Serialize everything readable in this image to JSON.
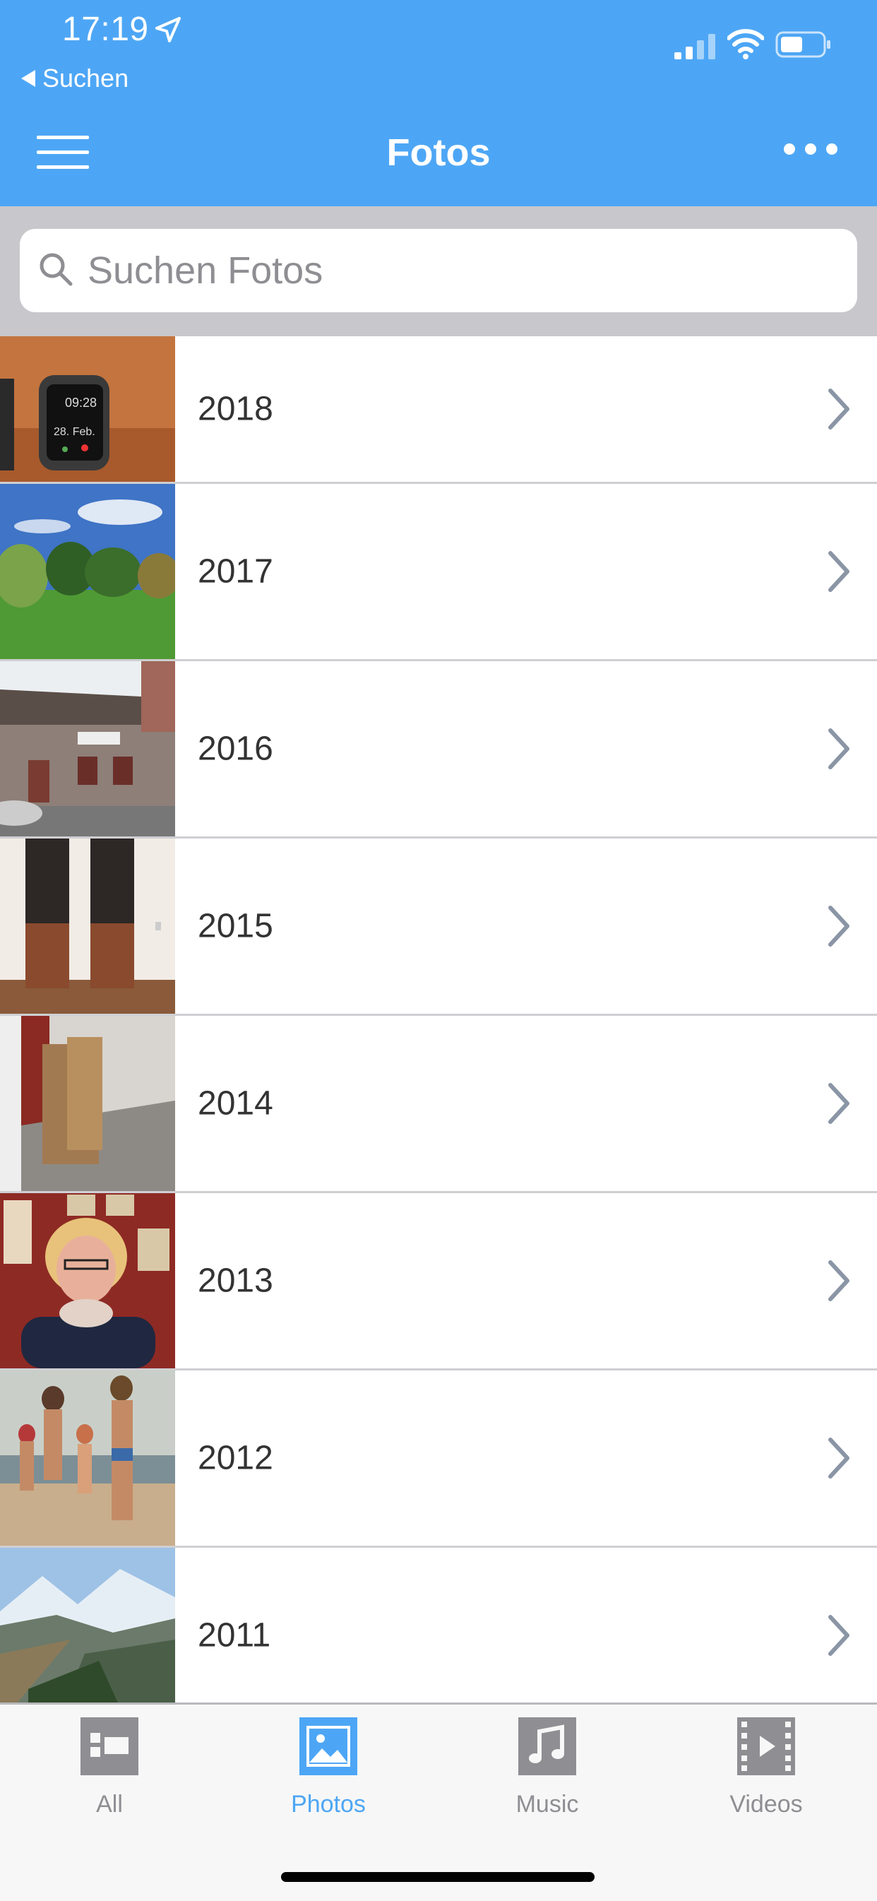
{
  "status_bar": {
    "time": "17:19"
  },
  "nav": {
    "back_label": "Suchen",
    "title": "Fotos"
  },
  "search": {
    "placeholder": "Suchen Fotos",
    "value": ""
  },
  "years": [
    {
      "label": "2018",
      "thumb": "apple-watch-photo"
    },
    {
      "label": "2017",
      "thumb": "park-trees-photo"
    },
    {
      "label": "2016",
      "thumb": "old-building-photo"
    },
    {
      "label": "2015",
      "thumb": "speakers-photo"
    },
    {
      "label": "2014",
      "thumb": "boxes-room-photo"
    },
    {
      "label": "2013",
      "thumb": "woman-portrait-photo"
    },
    {
      "label": "2012",
      "thumb": "family-beach-photo"
    },
    {
      "label": "2011",
      "thumb": "mountain-valley-photo"
    }
  ],
  "tabs": [
    {
      "label": "All",
      "icon": "grid-icon",
      "active": false
    },
    {
      "label": "Photos",
      "icon": "photo-icon",
      "active": true
    },
    {
      "label": "Music",
      "icon": "music-note-icon",
      "active": false
    },
    {
      "label": "Videos",
      "icon": "film-icon",
      "active": false
    }
  ],
  "colors": {
    "accent": "#4da6f5",
    "tab_inactive": "#8e8e93",
    "separator": "#cfcfd3"
  }
}
